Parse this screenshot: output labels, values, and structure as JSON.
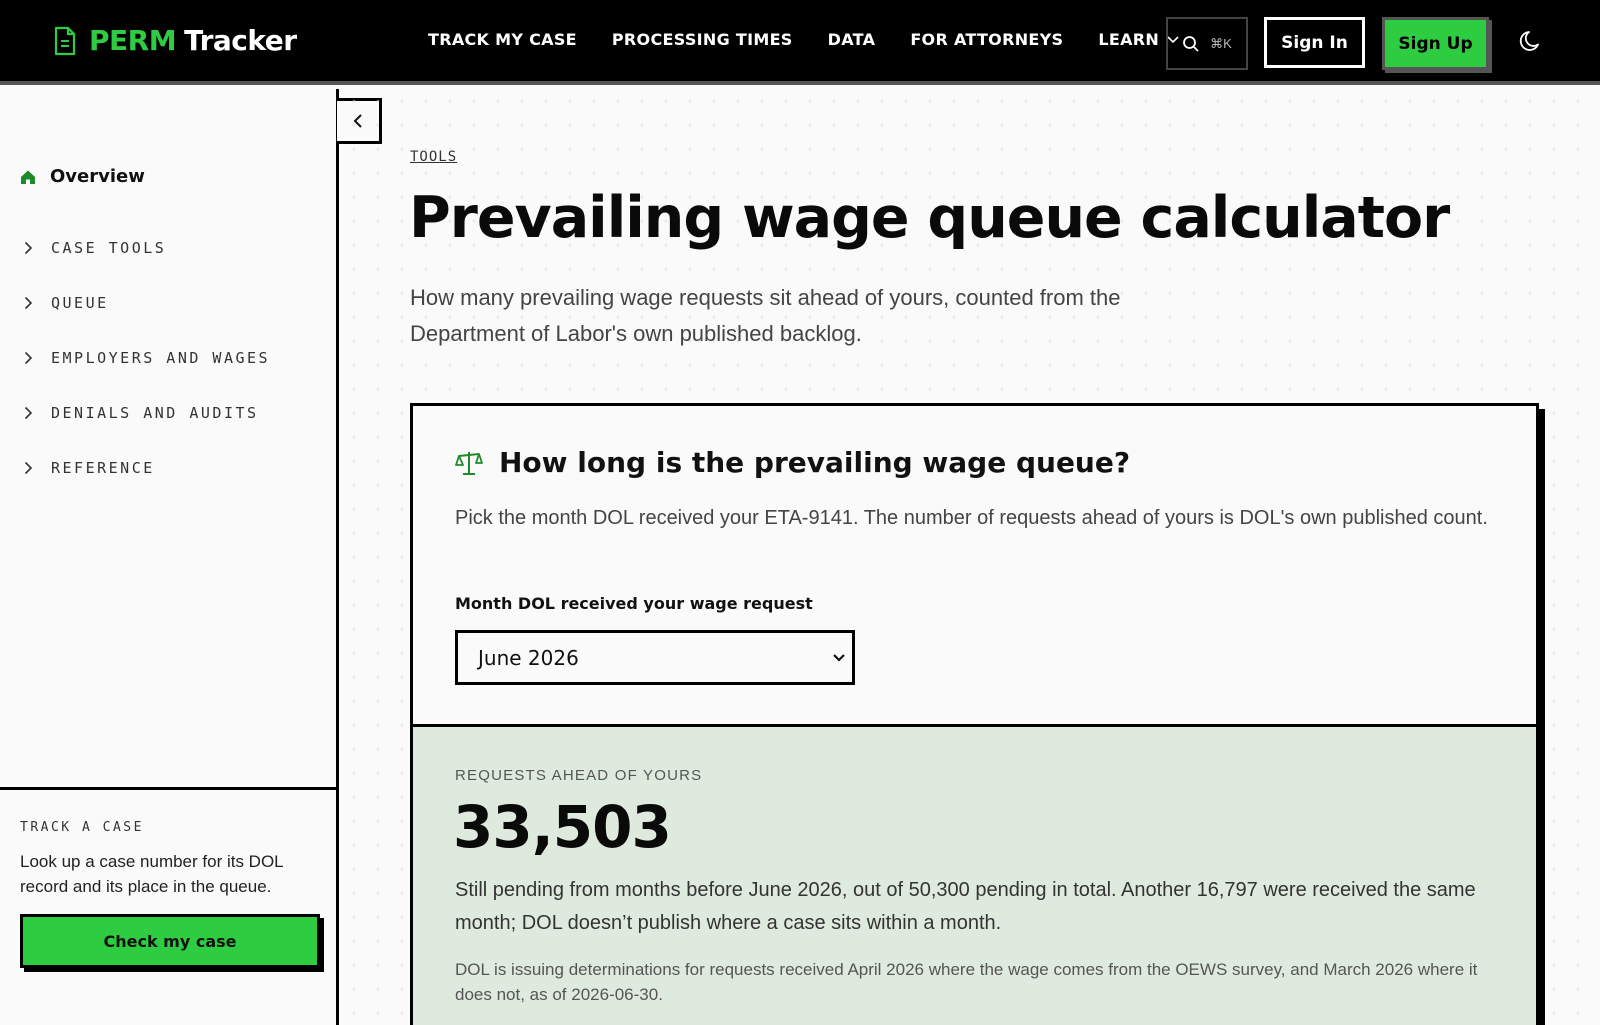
{
  "brand": {
    "name_part1": "PERM",
    "name_part2": "Tracker",
    "accent_color": "#2ecc40"
  },
  "nav": {
    "items": [
      "TRACK MY CASE",
      "PROCESSING TIMES",
      "DATA",
      "FOR ATTORNEYS",
      "LEARN"
    ],
    "search_shortcut": "⌘K",
    "sign_in": "Sign In",
    "sign_up": "Sign Up"
  },
  "sidebar": {
    "overview": "Overview",
    "sections": [
      "CASE TOOLS",
      "QUEUE",
      "EMPLOYERS AND WAGES",
      "DENIALS AND AUDITS",
      "REFERENCE"
    ],
    "track": {
      "label": "TRACK A CASE",
      "description": "Look up a case number for its DOL record and its place in the queue.",
      "button": "Check my case"
    }
  },
  "main": {
    "breadcrumb": "TOOLS",
    "title": "Prevailing wage queue calculator",
    "lede": "How many prevailing wage requests sit ahead of yours, counted from the Department of Labor's own published backlog.",
    "card": {
      "title": "How long is the prevailing wage queue?",
      "description": "Pick the month DOL received your ETA-9141. The number of requests ahead of yours is DOL's own published count.",
      "field_label": "Month DOL received your wage request",
      "selected_month": "June 2026",
      "result_label": "REQUESTS AHEAD OF YOURS",
      "result_value": "33,503",
      "result_description": "Still pending from months before June 2026, out of 50,300 pending in total. Another 16,797 were received the same month; DOL doesn’t publish where a case sits within a month.",
      "result_note": "DOL is issuing determinations for requests received April 2026 where the wage comes from the OEWS survey, and March 2026 where it does not, as of 2026-06-30."
    }
  }
}
